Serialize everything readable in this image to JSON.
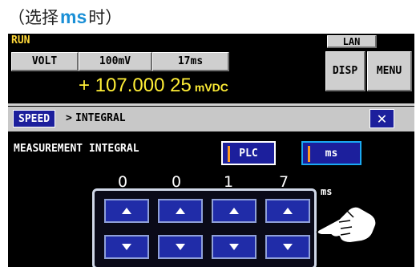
{
  "caption": {
    "prefix": "（选择",
    "highlight": "ms",
    "suffix": "时）"
  },
  "status": {
    "run": "RUN",
    "lan": "LAN"
  },
  "header": {
    "function": "VOLT",
    "range": "100mV",
    "rate": "17ms",
    "disp_label": "DISP",
    "menu_label": "MENU"
  },
  "reading": {
    "value": "+ 107.000 25",
    "unit": "mVDC"
  },
  "breadcrumb": {
    "parent": "SPEED",
    "separator": ">",
    "current": "INTEGRAL",
    "close": "✕"
  },
  "integral": {
    "label": "MEASUREMENT INTEGRAL",
    "options": [
      "PLC",
      "ms"
    ],
    "selected": "ms",
    "digits": [
      "0",
      "0",
      "1",
      "7"
    ],
    "unit": "ms"
  },
  "colors": {
    "screen_bg": "#000000",
    "button_blue": "#1c1f9c",
    "reading_yellow": "#ffee36",
    "caption_accent": "#1a8fd6",
    "selected_border": "#1aa9f2"
  },
  "icons": {
    "up": "triangle-up-icon",
    "down": "triangle-down-icon",
    "pointer": "pointing-hand-icon"
  }
}
